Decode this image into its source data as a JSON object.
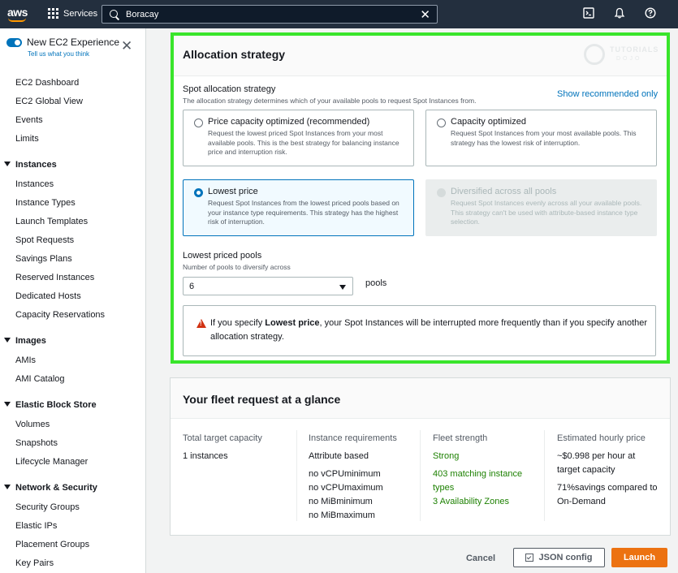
{
  "topbar": {
    "logo": "aws",
    "services_label": "Services",
    "search_value": "Boracay",
    "icons": [
      "cloudshell-icon",
      "notifications-icon",
      "help-icon"
    ]
  },
  "sidebar": {
    "experience_label": "New EC2 Experience",
    "experience_link": "Tell us what you think",
    "items": [
      {
        "type": "item",
        "label": "EC2 Dashboard"
      },
      {
        "type": "item",
        "label": "EC2 Global View"
      },
      {
        "type": "item",
        "label": "Events"
      },
      {
        "type": "item",
        "label": "Limits"
      },
      {
        "type": "section",
        "label": "Instances"
      },
      {
        "type": "item",
        "label": "Instances"
      },
      {
        "type": "item",
        "label": "Instance Types"
      },
      {
        "type": "item",
        "label": "Launch Templates"
      },
      {
        "type": "item",
        "label": "Spot Requests"
      },
      {
        "type": "item",
        "label": "Savings Plans"
      },
      {
        "type": "item",
        "label": "Reserved Instances"
      },
      {
        "type": "item",
        "label": "Dedicated Hosts"
      },
      {
        "type": "item",
        "label": "Capacity Reservations"
      },
      {
        "type": "section",
        "label": "Images"
      },
      {
        "type": "item",
        "label": "AMIs"
      },
      {
        "type": "item",
        "label": "AMI Catalog"
      },
      {
        "type": "section",
        "label": "Elastic Block Store"
      },
      {
        "type": "item",
        "label": "Volumes"
      },
      {
        "type": "item",
        "label": "Snapshots"
      },
      {
        "type": "item",
        "label": "Lifecycle Manager"
      },
      {
        "type": "section",
        "label": "Network & Security"
      },
      {
        "type": "item",
        "label": "Security Groups"
      },
      {
        "type": "item",
        "label": "Elastic IPs"
      },
      {
        "type": "item",
        "label": "Placement Groups"
      },
      {
        "type": "item",
        "label": "Key Pairs"
      }
    ]
  },
  "allocation": {
    "title": "Allocation strategy",
    "watermark": {
      "line1": "TUTORIALS",
      "line2": "DOJO"
    },
    "spot_label": "Spot allocation strategy",
    "spot_desc": "The allocation strategy determines which of your available pools to request Spot Instances from.",
    "show_recommended": "Show recommended only",
    "options": [
      {
        "title": "Price capacity optimized (recommended)",
        "desc": "Request the lowest priced Spot Instances from your most available pools. This is the best strategy for balancing instance price and interruption risk.",
        "state": "unselected"
      },
      {
        "title": "Capacity optimized",
        "desc": "Request Spot Instances from your most available pools. This strategy has the lowest risk of interruption.",
        "state": "unselected"
      },
      {
        "title": "Lowest price",
        "desc": "Request Spot Instances from the lowest priced pools based on your instance type requirements. This strategy has the highest risk of interruption.",
        "state": "selected"
      },
      {
        "title": "Diversified across all pools",
        "desc": "Request Spot Instances evenly across all your available pools. This strategy can't be used with attribute-based instance type selection.",
        "state": "disabled"
      }
    ],
    "pools_label": "Lowest priced pools",
    "pools_desc": "Number of pools to diversify across",
    "pools_value": "6",
    "pools_suffix": "pools",
    "warning": {
      "prefix": "If you specify ",
      "bold": "Lowest price",
      "suffix": ", your Spot Instances will be interrupted more frequently than if you specify another allocation strategy."
    }
  },
  "glance": {
    "title": "Your fleet request at a glance",
    "columns": {
      "capacity": {
        "head": "Total target capacity",
        "value": "1 instances"
      },
      "requirements": {
        "head": "Instance requirements",
        "value": "Attribute based",
        "lines": [
          "no vCPUminimum",
          "no vCPUmaximum",
          "no MiBminimum",
          "no MiBmaximum"
        ]
      },
      "strength": {
        "head": "Fleet strength",
        "value": "Strong",
        "match": "403 matching instance types",
        "zones": "3 Availability Zones"
      },
      "price": {
        "head": "Estimated hourly price",
        "value": "~$0.998 per hour at target capacity",
        "savings": "71%savings compared to On-Demand"
      }
    }
  },
  "footer": {
    "cancel": "Cancel",
    "json": "JSON config",
    "launch": "Launch"
  },
  "colors": {
    "highlight": "#39e52b",
    "accent": "#0073bb",
    "launch": "#ec7211",
    "strong_green": "#1d8102"
  }
}
